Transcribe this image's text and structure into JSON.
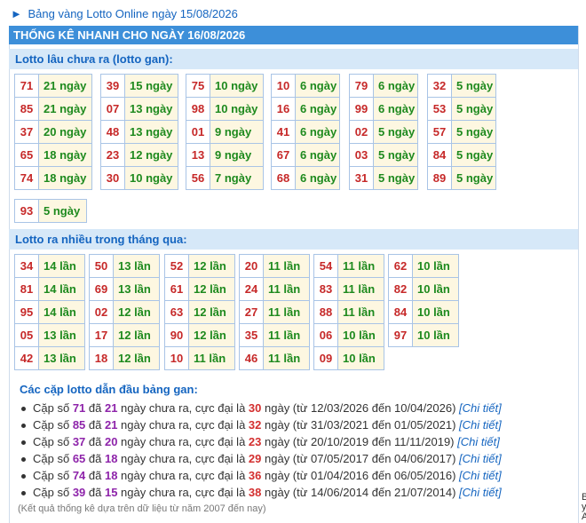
{
  "top_link": {
    "arrow": "►",
    "text": "Bảng vàng Lotto Online ngày 15/08/2026"
  },
  "header": {
    "title": "THỐNG KÊ NHANH CHO NGÀY 16/08/2026"
  },
  "gan": {
    "title": "Lotto lâu chưa ra (lotto gan):",
    "columns": [
      [
        {
          "n": "71",
          "v": "21 ngày"
        },
        {
          "n": "85",
          "v": "21 ngày"
        },
        {
          "n": "37",
          "v": "20 ngày"
        },
        {
          "n": "65",
          "v": "18 ngày"
        },
        {
          "n": "74",
          "v": "18 ngày"
        }
      ],
      [
        {
          "n": "39",
          "v": "15 ngày"
        },
        {
          "n": "07",
          "v": "13 ngày"
        },
        {
          "n": "48",
          "v": "13 ngày"
        },
        {
          "n": "23",
          "v": "12 ngày"
        },
        {
          "n": "30",
          "v": "10 ngày"
        }
      ],
      [
        {
          "n": "75",
          "v": "10 ngày"
        },
        {
          "n": "98",
          "v": "10 ngày"
        },
        {
          "n": "01",
          "v": "9 ngày"
        },
        {
          "n": "13",
          "v": "9 ngày"
        },
        {
          "n": "56",
          "v": "7 ngày"
        }
      ],
      [
        {
          "n": "10",
          "v": "6 ngày"
        },
        {
          "n": "16",
          "v": "6 ngày"
        },
        {
          "n": "41",
          "v": "6 ngày"
        },
        {
          "n": "67",
          "v": "6 ngày"
        },
        {
          "n": "68",
          "v": "6 ngày"
        }
      ],
      [
        {
          "n": "79",
          "v": "6 ngày"
        },
        {
          "n": "99",
          "v": "6 ngày"
        },
        {
          "n": "02",
          "v": "5 ngày"
        },
        {
          "n": "03",
          "v": "5 ngày"
        },
        {
          "n": "31",
          "v": "5 ngày"
        }
      ],
      [
        {
          "n": "32",
          "v": "5 ngày"
        },
        {
          "n": "53",
          "v": "5 ngày"
        },
        {
          "n": "57",
          "v": "5 ngày"
        },
        {
          "n": "84",
          "v": "5 ngày"
        },
        {
          "n": "89",
          "v": "5 ngày"
        }
      ]
    ],
    "extra": {
      "n": "93",
      "v": "5 ngày"
    }
  },
  "frequent": {
    "title": "Lotto ra nhiều trong tháng qua:",
    "columns": [
      [
        {
          "n": "34",
          "v": "14 lần"
        },
        {
          "n": "81",
          "v": "14 lần"
        },
        {
          "n": "95",
          "v": "14 lần"
        },
        {
          "n": "05",
          "v": "13 lần"
        },
        {
          "n": "42",
          "v": "13 lần"
        }
      ],
      [
        {
          "n": "50",
          "v": "13 lần"
        },
        {
          "n": "69",
          "v": "13 lần"
        },
        {
          "n": "02",
          "v": "12 lần"
        },
        {
          "n": "17",
          "v": "12 lần"
        },
        {
          "n": "18",
          "v": "12 lần"
        }
      ],
      [
        {
          "n": "52",
          "v": "12 lần"
        },
        {
          "n": "61",
          "v": "12 lần"
        },
        {
          "n": "63",
          "v": "12 lần"
        },
        {
          "n": "90",
          "v": "12 lần"
        },
        {
          "n": "10",
          "v": "11 lần"
        }
      ],
      [
        {
          "n": "20",
          "v": "11 lần"
        },
        {
          "n": "24",
          "v": "11 lần"
        },
        {
          "n": "27",
          "v": "11 lần"
        },
        {
          "n": "35",
          "v": "11 lần"
        },
        {
          "n": "46",
          "v": "11 lần"
        }
      ],
      [
        {
          "n": "54",
          "v": "11 lần"
        },
        {
          "n": "83",
          "v": "11 lần"
        },
        {
          "n": "88",
          "v": "11 lần"
        },
        {
          "n": "06",
          "v": "10 lần"
        },
        {
          "n": "09",
          "v": "10 lần"
        }
      ],
      [
        {
          "n": "62",
          "v": "10 lần"
        },
        {
          "n": "82",
          "v": "10 lần"
        },
        {
          "n": "84",
          "v": "10 lần"
        },
        {
          "n": "97",
          "v": "10 lần"
        }
      ]
    ]
  },
  "pairs": {
    "title": "Các cặp lotto dẫn đầu bảng gan:",
    "items": [
      {
        "pair": "71",
        "days": "21",
        "max": "30",
        "from": "12/03/2026",
        "to": "10/04/2026"
      },
      {
        "pair": "85",
        "days": "21",
        "max": "32",
        "from": "31/03/2021",
        "to": "01/05/2021"
      },
      {
        "pair": "37",
        "days": "20",
        "max": "23",
        "from": "20/10/2019",
        "to": "11/11/2019"
      },
      {
        "pair": "65",
        "days": "18",
        "max": "29",
        "from": "07/05/2017",
        "to": "04/06/2017"
      },
      {
        "pair": "74",
        "days": "18",
        "max": "36",
        "from": "01/04/2016",
        "to": "06/05/2016"
      },
      {
        "pair": "39",
        "days": "15",
        "max": "38",
        "from": "14/06/2014",
        "to": "21/07/2014"
      }
    ],
    "labels": {
      "prefix": "Cặp số",
      "mid1": "đã",
      "mid2": "ngày chưa ra, cực đại là",
      "mid3": "ngày (từ",
      "mid4": "đến",
      "close": ")",
      "link": "[Chi tiết]"
    }
  },
  "note": "(Kết quả thống kê dựa trên dữ liệu từ năm 2007 đến nay)",
  "side_fragment": "B\ny\nA"
}
